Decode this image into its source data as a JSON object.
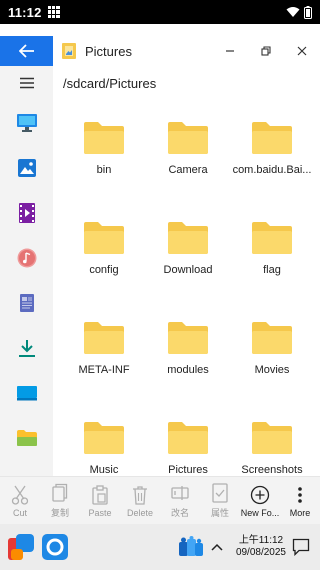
{
  "statusbar": {
    "time": "11:12"
  },
  "window": {
    "title": "Pictures"
  },
  "path": "/sdcard/Pictures",
  "sidebar": {
    "items": [
      {
        "name": "computer",
        "color": "#1e88e5"
      },
      {
        "name": "pictures",
        "color": "#1976d2"
      },
      {
        "name": "videos",
        "color": "#7b1fa2"
      },
      {
        "name": "music",
        "color": "#e57373"
      },
      {
        "name": "documents",
        "color": "#5c6bc0"
      },
      {
        "name": "downloads",
        "color": "#00897b"
      },
      {
        "name": "desktop",
        "color": "#039be5"
      },
      {
        "name": "folder",
        "color": "#8bc34a"
      }
    ]
  },
  "files": [
    {
      "label": "bin"
    },
    {
      "label": "Camera"
    },
    {
      "label": "com.baidu.Bai..."
    },
    {
      "label": "config"
    },
    {
      "label": "Download"
    },
    {
      "label": "flag"
    },
    {
      "label": "META-INF"
    },
    {
      "label": "modules"
    },
    {
      "label": "Movies"
    },
    {
      "label": "Music"
    },
    {
      "label": "Pictures"
    },
    {
      "label": "Screenshots"
    }
  ],
  "toolbar": {
    "cut": "Cut",
    "copy": "复制",
    "paste": "Paste",
    "delete": "Delete",
    "rename": "改名",
    "properties": "属性",
    "new_folder": "New Fo...",
    "more": "More"
  },
  "taskbar": {
    "time": "上午11:12",
    "date": "09/08/2025"
  },
  "colors": {
    "accent": "#1a73e8",
    "folder": "#f5c84c",
    "folder_front": "#fbd96b"
  }
}
